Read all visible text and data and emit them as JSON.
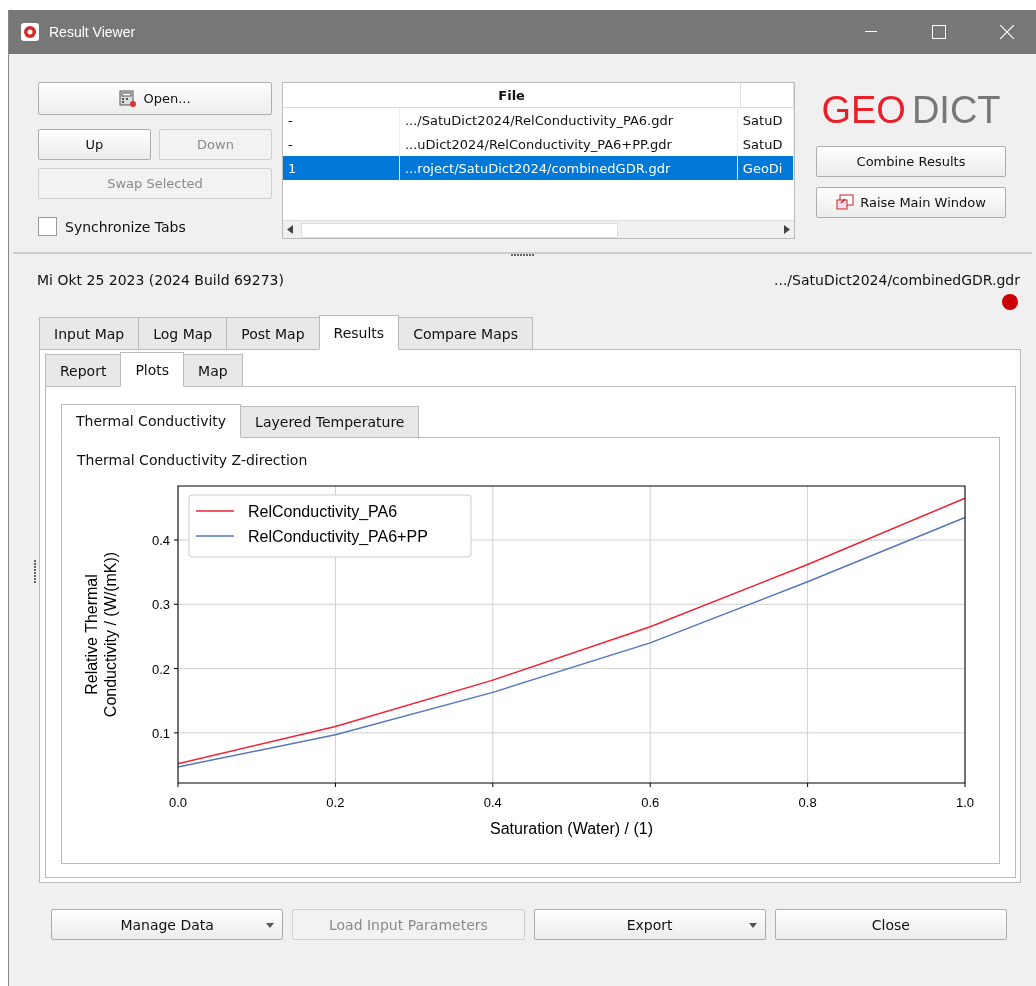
{
  "window": {
    "title": "Result Viewer"
  },
  "left_buttons": [
    {
      "label": "Open...",
      "disabled": false,
      "kind": "open"
    },
    {
      "label": "Up",
      "disabled": false,
      "kind": "half"
    },
    {
      "label": "Down",
      "disabled": true,
      "kind": "half"
    },
    {
      "label": "Swap Selected",
      "disabled": true,
      "kind": "full"
    }
  ],
  "sync_tabs": {
    "label": "Synchronize Tabs",
    "checked": false
  },
  "file_table": {
    "columns": [
      "File"
    ],
    "rows": [
      {
        "marker": "-",
        "file": ".../SatuDict2024/RelConductivity_PA6.gdr",
        "column_3": "SatuD",
        "selected": false
      },
      {
        "marker": "-",
        "file": "...uDict2024/RelConductivity_PA6+PP.gdr",
        "column_3": "SatuD",
        "selected": false
      },
      {
        "marker": "1",
        "file": "...roject/SatuDict2024/combinedGDR.gdr",
        "column_3": "GeoDi",
        "selected": true
      }
    ]
  },
  "logo": {
    "part_1": "GEO",
    "part_2": "DICT"
  },
  "right_buttons": [
    {
      "label": "Combine Results",
      "kind": "plain"
    },
    {
      "label": "Raise Main Window",
      "kind": "raise"
    }
  ],
  "info": {
    "build": "Mi Okt 25 2023 (2024 Build 69273)",
    "file": ".../SatuDict2024/combinedGDR.gdr"
  },
  "main_tabs": [
    {
      "label": "Input Map",
      "selected": false
    },
    {
      "label": "Log Map",
      "selected": false
    },
    {
      "label": "Post Map",
      "selected": false
    },
    {
      "label": "Results",
      "selected": true
    },
    {
      "label": "Compare Maps",
      "selected": false
    }
  ],
  "sub_tabs": [
    {
      "label": "Report",
      "selected": false
    },
    {
      "label": "Plots",
      "selected": true
    },
    {
      "label": "Map",
      "selected": false
    }
  ],
  "plot_tabs": [
    {
      "label": "Thermal Conductivity",
      "selected": true
    },
    {
      "label": "Layered Temperature",
      "selected": false
    }
  ],
  "plot": {
    "title": "Thermal Conductivity Z-direction",
    "chart_data": {
      "type": "line",
      "grid": true,
      "legend": true,
      "xlabel": "Saturation (Water) / (1)",
      "ylabel": "Relative Thermal\nConductivity / (W/(mK))",
      "x": [
        0,
        0.2,
        0.4,
        0.6,
        0.8,
        1.0
      ],
      "series": [
        {
          "name": "RelConductivity_PA6",
          "color": "#ee2233",
          "values": [
            0.052,
            0.11,
            0.182,
            0.265,
            0.362,
            0.465
          ]
        },
        {
          "name": "RelConductivity_PA6+PP",
          "color": "#5577bb",
          "values": [
            0.047,
            0.097,
            0.163,
            0.24,
            0.335,
            0.435
          ]
        }
      ],
      "xlim": [
        0,
        1
      ],
      "ylim": [
        0.022,
        0.484
      ],
      "xticks": [
        {
          "value": 0,
          "label": "0.0"
        },
        {
          "value": 0.2,
          "label": "0.2"
        },
        {
          "value": 0.4,
          "label": "0.4"
        },
        {
          "value": 0.6,
          "label": "0.6"
        },
        {
          "value": 0.8,
          "label": "0.8"
        },
        {
          "value": 1,
          "label": "1.0"
        }
      ],
      "yticks": [
        {
          "value": 0.1,
          "label": "0.1"
        },
        {
          "value": 0.2,
          "label": "0.2"
        },
        {
          "value": 0.3,
          "label": "0.3"
        },
        {
          "value": 0.4,
          "label": "0.4"
        }
      ]
    }
  },
  "bottom_buttons": [
    {
      "label": "Manage Data",
      "disabled": false,
      "kind": "menu"
    },
    {
      "label": "Load Input Parameters",
      "disabled": true,
      "kind": "plain"
    },
    {
      "label": "Export",
      "disabled": false,
      "kind": "menu"
    },
    {
      "label": "Close",
      "disabled": false,
      "kind": "plain"
    }
  ]
}
